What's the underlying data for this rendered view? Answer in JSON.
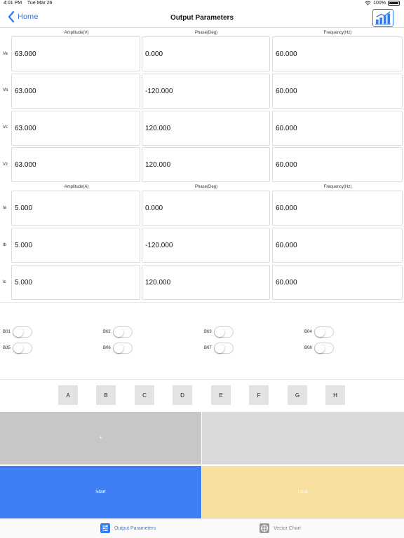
{
  "status_bar": {
    "time": "4:01 PM",
    "date": "Tue Mar 26",
    "battery": "100%"
  },
  "nav": {
    "back_label": "Home",
    "title": "Output Parameters"
  },
  "voltage_headers": {
    "amplitude": "Amplitude(V)",
    "phase": "Phase(Deg)",
    "frequency": "Frequency(Hz)"
  },
  "voltage_rows": [
    {
      "label": "Va",
      "amplitude": "63.000",
      "phase": "0.000",
      "frequency": "60.000"
    },
    {
      "label": "Vb",
      "amplitude": "63.000",
      "phase": "-120.000",
      "frequency": "60.000"
    },
    {
      "label": "Vc",
      "amplitude": "63.000",
      "phase": "120.000",
      "frequency": "60.000"
    },
    {
      "label": "Vz",
      "amplitude": "63.000",
      "phase": "120.000",
      "frequency": "60.000"
    }
  ],
  "current_headers": {
    "amplitude": "Amplitude(A)",
    "phase": "Phase(Deg)",
    "frequency": "Frequency(Hz)"
  },
  "current_rows": [
    {
      "label": "Ia",
      "amplitude": "5.000",
      "phase": "0.000",
      "frequency": "60.000"
    },
    {
      "label": "Ib",
      "amplitude": "5.000",
      "phase": "-120.000",
      "frequency": "60.000"
    },
    {
      "label": "Ic",
      "amplitude": "5.000",
      "phase": "120.000",
      "frequency": "60.000"
    }
  ],
  "binary_outputs": [
    "B01",
    "B02",
    "B03",
    "B04",
    "B05",
    "B06",
    "B07",
    "B08"
  ],
  "letter_buttons": [
    "A",
    "B",
    "C",
    "D",
    "E",
    "F",
    "G",
    "H"
  ],
  "actions": {
    "plus": "+",
    "minus": "-",
    "start": "Start",
    "lock": "Lock"
  },
  "tabs": [
    {
      "label": "Output Parameters",
      "icon": "sliders-icon",
      "active": true
    },
    {
      "label": "Vector Chart",
      "icon": "crosshair-icon",
      "active": false
    }
  ],
  "colors": {
    "accent": "#2f7cf6",
    "start_button": "#3f7ff5",
    "lock_button": "#f7dfa0",
    "plus_button": "#c7c7c7",
    "minus_button": "#d9d9d9",
    "tab_inactive": "#888888"
  }
}
